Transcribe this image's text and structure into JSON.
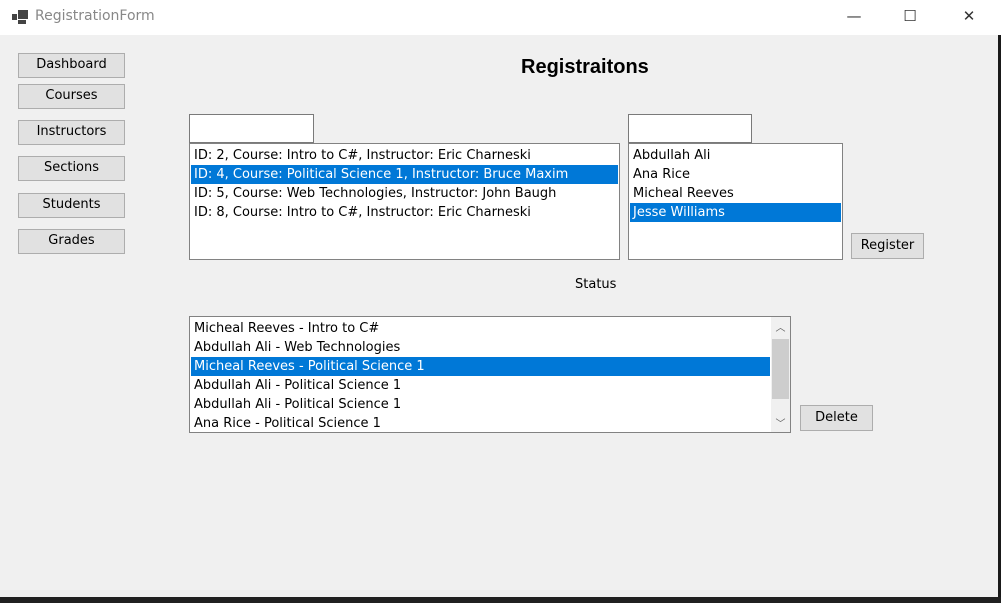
{
  "window": {
    "title": "RegistrationForm",
    "minimize": "—",
    "maximize": "☐",
    "close": "✕"
  },
  "nav": [
    "Dashboard",
    "Courses",
    "Instructors",
    "Sections",
    "Students",
    "Grades"
  ],
  "heading": "Registraitons",
  "sections_filter": {
    "value": ""
  },
  "students_filter": {
    "value": ""
  },
  "sections": [
    "ID: 2, Course: Intro to C#, Instructor: Eric Charneski",
    "ID: 4, Course: Political Science 1, Instructor: Bruce Maxim",
    "ID: 5, Course: Web Technologies, Instructor: John Baugh",
    "ID: 8, Course: Intro to C#, Instructor: Eric Charneski"
  ],
  "sections_selected": 1,
  "students": [
    "Abdullah Ali",
    "Ana Rice",
    "Micheal Reeves",
    "Jesse Williams"
  ],
  "students_selected": 3,
  "register_label": "Register",
  "status_label": "Status",
  "registrations": [
    "Micheal Reeves - Intro to C#",
    "Abdullah Ali - Web Technologies",
    "Micheal Reeves - Political Science 1",
    "Abdullah Ali - Political Science 1",
    "Abdullah Ali - Political Science 1",
    "Ana Rice - Political Science 1"
  ],
  "registrations_selected": 2,
  "delete_label": "Delete",
  "colors": {
    "selection": "#0078d7"
  }
}
